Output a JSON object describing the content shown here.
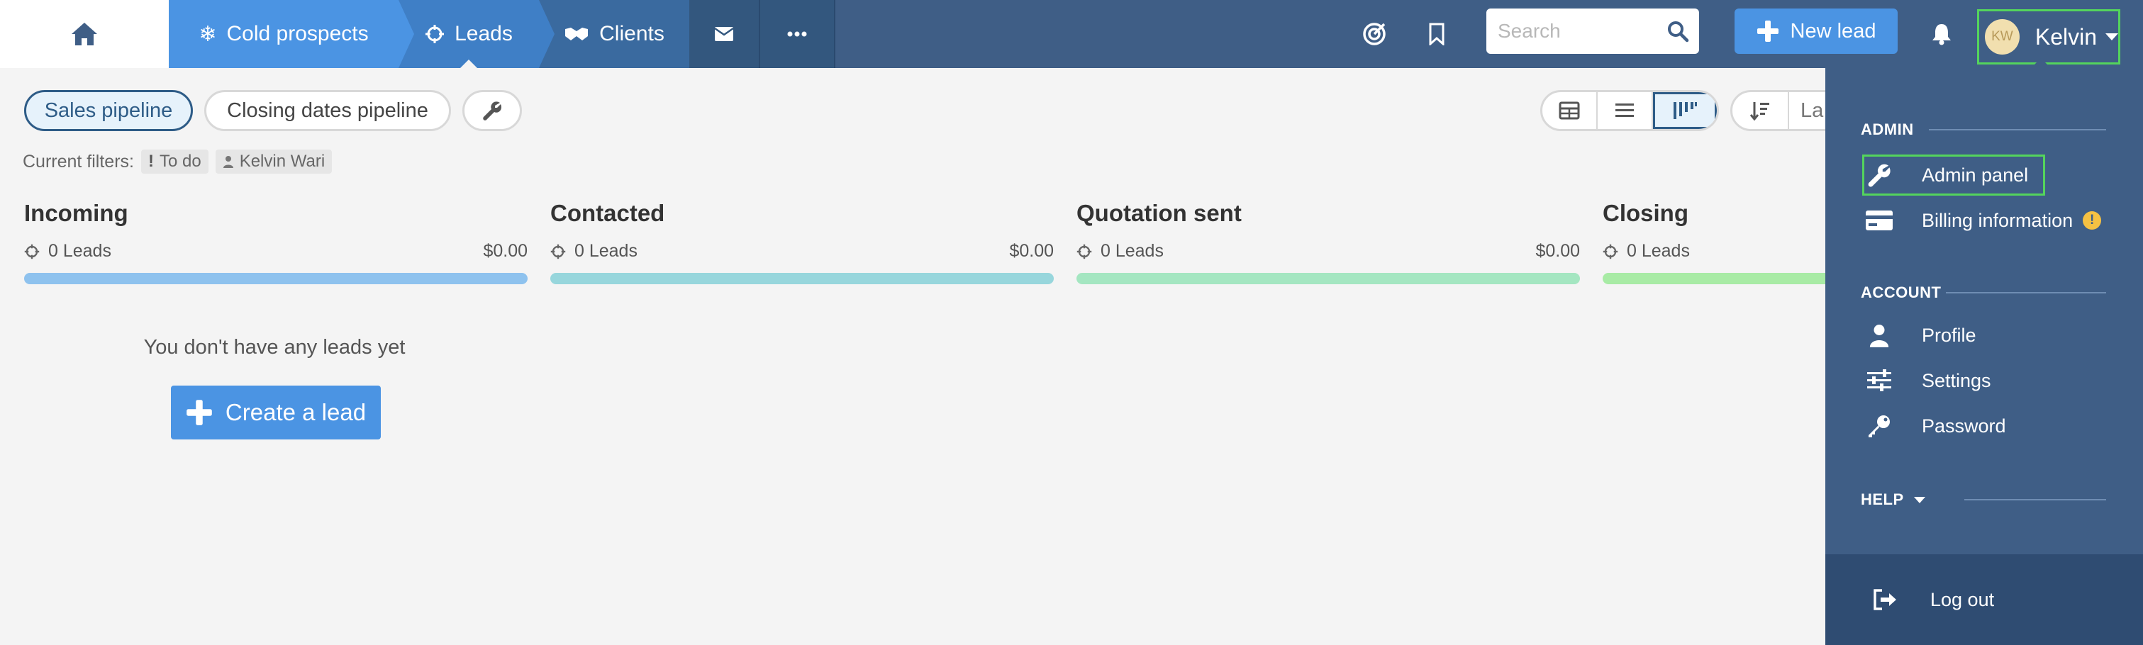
{
  "nav": {
    "home_icon": "home-icon",
    "cold_prospects": "Cold prospects",
    "leads": "Leads",
    "clients": "Clients",
    "mail_icon": "envelope-icon",
    "more_icon": "ellipsis-icon"
  },
  "header": {
    "search_placeholder": "Search",
    "new_lead": "New lead",
    "user_name": "Kelvin",
    "user_initials": "KW"
  },
  "toolbar": {
    "pipelines": [
      "Sales pipeline",
      "Closing dates pipeline"
    ],
    "active_pipeline": "Sales pipeline",
    "sort_label": "La"
  },
  "filters": {
    "label": "Current filters:",
    "chips": [
      "To do",
      "Kelvin Wari"
    ]
  },
  "columns": [
    {
      "title": "Incoming",
      "count": "0 Leads",
      "amount": "$0.00",
      "color": "#8ec2ee"
    },
    {
      "title": "Contacted",
      "count": "0 Leads",
      "amount": "$0.00",
      "color": "#97d6dc"
    },
    {
      "title": "Quotation sent",
      "count": "0 Leads",
      "amount": "$0.00",
      "color": "#a4e6c1"
    },
    {
      "title": "Closing",
      "count": "0 Leads",
      "amount": "",
      "color": "#a8eba5"
    }
  ],
  "empty": {
    "message": "You don't have any leads yet",
    "create_button": "Create a lead"
  },
  "menu": {
    "admin_heading": "ADMIN",
    "admin_panel": "Admin panel",
    "billing": "Billing information",
    "billing_warning": "!",
    "account_heading": "ACCOUNT",
    "profile": "Profile",
    "settings": "Settings",
    "password": "Password",
    "help_heading": "HELP",
    "logout": "Log out"
  },
  "colors": {
    "nav_bg": "#3f5e86",
    "accent": "#4b94e3",
    "highlight": "#54d45c"
  }
}
